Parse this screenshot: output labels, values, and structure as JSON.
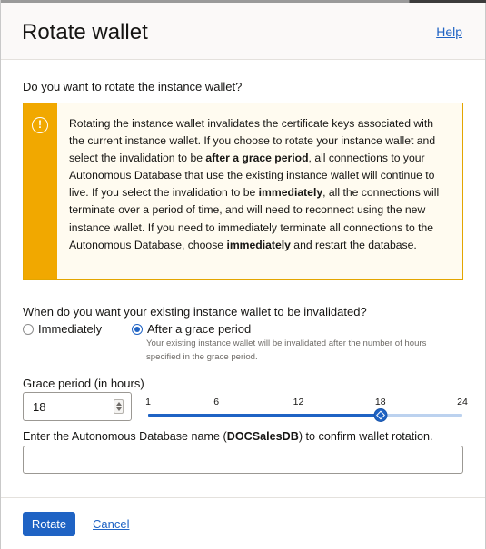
{
  "dialog": {
    "title": "Rotate wallet",
    "help_label": "Help"
  },
  "question_rotate": "Do you want to rotate the instance wallet?",
  "warning": {
    "icon": "exclamation-circle-icon",
    "text_1": "Rotating the instance wallet invalidates the certificate keys associated with the current instance wallet. If you choose to rotate your instance wallet and select the invalidation to be ",
    "bold_1": "after a grace period",
    "text_2": ", all connections to your Autonomous Database that use the existing instance wallet will continue to live. If you select the invalidation to be ",
    "bold_2": "immediately",
    "text_3": ", all the connections will terminate over a period of time, and will need to reconnect using the new instance wallet. If you need to immediately terminate all connections to the Autonomous Database, choose ",
    "bold_3": "immediately",
    "text_4": " and restart the database."
  },
  "invalidation": {
    "question": "When do you want your existing instance wallet to be invalidated?",
    "option_immediately": "Immediately",
    "option_grace": "After a grace period",
    "selected": "After a grace period",
    "grace_help": "Your existing instance wallet will be invalidated after the number of hours specified in the grace period."
  },
  "grace_period": {
    "label": "Grace period (in hours)",
    "value": "18",
    "slider_min": 1,
    "slider_max": 24,
    "slider_value": 18,
    "ticks": [
      "1",
      "6",
      "12",
      "18",
      "24"
    ]
  },
  "confirm": {
    "text_1": "Enter the Autonomous Database name (",
    "db_name": "DOCSalesDB",
    "text_2": ") to confirm wallet rotation.",
    "input_value": ""
  },
  "footer": {
    "rotate_label": "Rotate",
    "cancel_label": "Cancel"
  },
  "colors": {
    "accent": "#1f63c4",
    "warning": "#f1a800"
  }
}
